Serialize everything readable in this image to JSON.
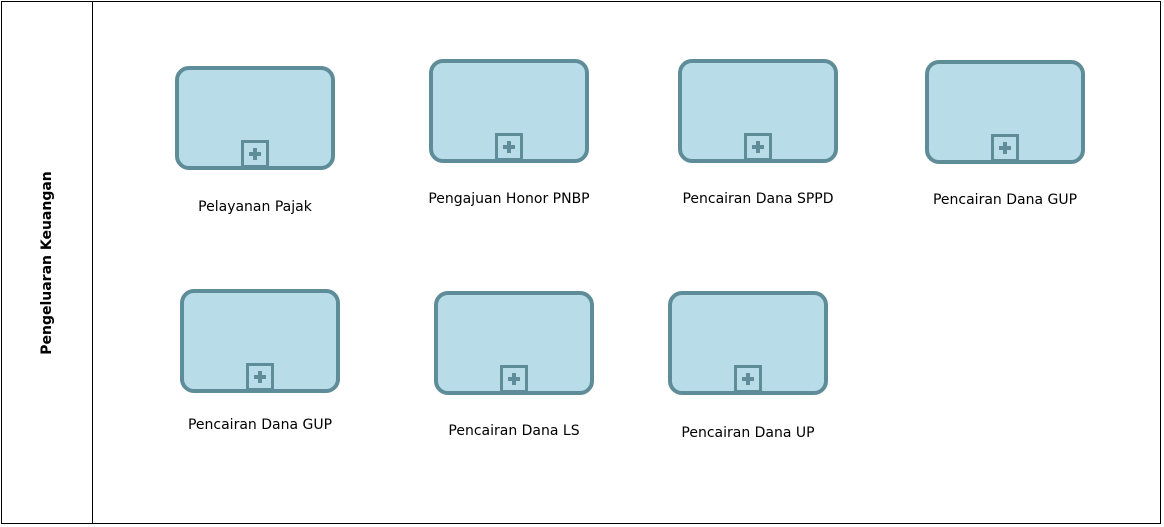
{
  "lane": {
    "label": "Pengeluaran Keuangan"
  },
  "tasks": [
    {
      "label": "Pelayanan Pajak"
    },
    {
      "label": "Pengajuan Honor PNBP"
    },
    {
      "label": "Pencairan Dana SPPD"
    },
    {
      "label": "Pencairan Dana GUP"
    },
    {
      "label": "Pencairan Dana GUP"
    },
    {
      "label": "Pencairan Dana LS"
    },
    {
      "label": "Pencairan Dana UP"
    }
  ],
  "colors": {
    "task_fill": "#b8dde8",
    "task_border": "#5f8c99"
  },
  "icons": {
    "subprocess_marker": "plus-box-icon"
  }
}
